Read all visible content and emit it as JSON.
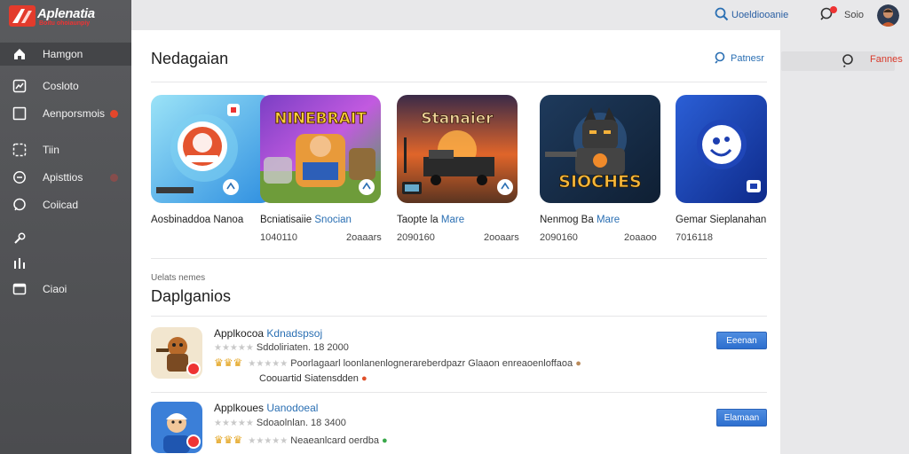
{
  "brand": {
    "name": "Aplenatia",
    "tagline": "Boitu ohoiaunpiy"
  },
  "sidebar": {
    "items": [
      {
        "label": "Hamgon",
        "icon": "home-icon"
      },
      {
        "label": "Cosloto",
        "icon": "chart-icon"
      },
      {
        "label": "Aenporsmois",
        "icon": "square-icon"
      },
      {
        "label": "Tiin",
        "icon": "dashed-box-icon"
      },
      {
        "label": "Apisttios",
        "icon": "globe-icon"
      },
      {
        "label": "Coiicad",
        "icon": "chat-icon"
      },
      {
        "label": "",
        "icon": "wrench-icon"
      },
      {
        "label": "",
        "icon": "bars-icon"
      },
      {
        "label": "Ciaoi",
        "icon": "card-icon"
      }
    ]
  },
  "topbar": {
    "search_label": "Uoeldiooanie",
    "user_label": "Soio"
  },
  "right_panel": {
    "search_label": "Fannes"
  },
  "featured": {
    "title": "Nedagaian",
    "link_label": "Patnesr",
    "cards": [
      {
        "title": "Aosbinaddoa Nanoa",
        "title_accent": "",
        "meta": "",
        "meta_right": "",
        "art": "cat-art"
      },
      {
        "title": "Bcniatisaiie",
        "title_accent": "Snocian",
        "meta": "1040110",
        "meta_right": "2oaaars",
        "art": "crane-art",
        "art_text": "NINEBRAIT"
      },
      {
        "title": "Taopte la",
        "title_accent": "Mare",
        "meta": "2090160",
        "meta_right": "2ooaars",
        "art": "truck-art",
        "art_text": "Stanaier"
      },
      {
        "title": "Nenmog Ba",
        "title_accent": "Mare",
        "meta": "2090160",
        "meta_right": "2oaaoo",
        "art": "robot-art",
        "art_text": "SIOCHES"
      },
      {
        "title": "Gemar Sieplanahan",
        "title_accent": "",
        "meta": "7016118",
        "meta_right": "",
        "art": "ghost-art"
      }
    ]
  },
  "downloads": {
    "sublabel": "Uelats nemes",
    "title": "Daplganios",
    "rows": [
      {
        "title": "Applkocoa",
        "title_accent": "Kdnadspsoj",
        "info": "Sddoliriaten. 18 2000",
        "review": "Poorlagaarl loonlanenlognerareberdpazr Glaaon enreaoenloffaoa",
        "note": "Coouartid Siatensdden",
        "button": "Eeenan"
      },
      {
        "title": "Applkoues",
        "title_accent": "Uanodoeal",
        "info": "Sdoaolnlan.  18 3400",
        "review": "Neaeanlcard oerdba",
        "note": "",
        "button": "Elamaan"
      }
    ]
  }
}
